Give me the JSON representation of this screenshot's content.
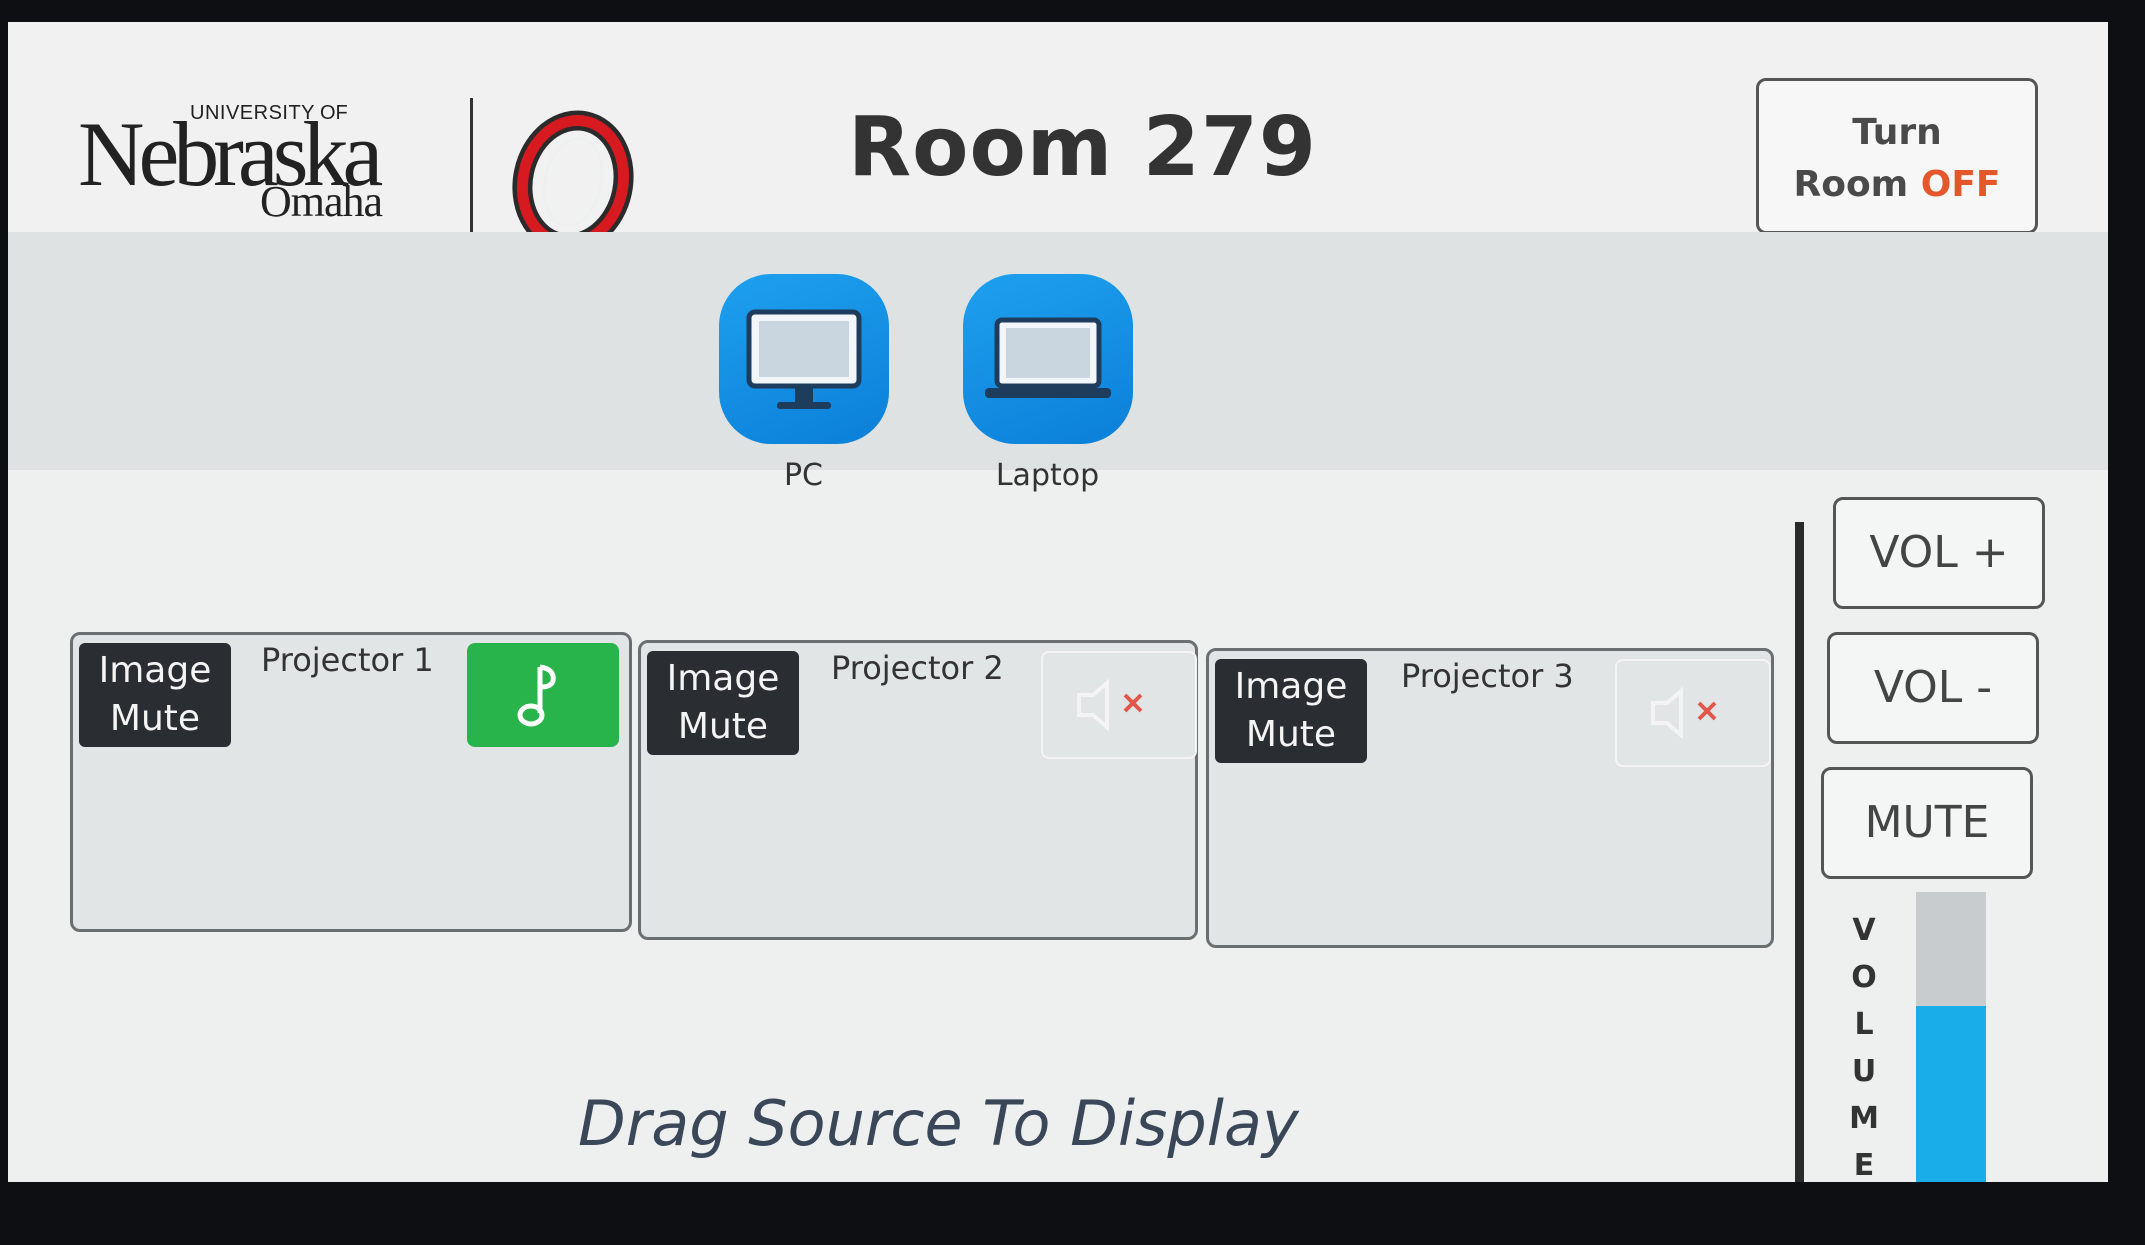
{
  "header": {
    "logo": {
      "university": "UNIVERSITY",
      "of": "OF",
      "nebraska": "Nebraska",
      "omaha": "Omaha"
    },
    "room_title": "Room 279",
    "power_button": {
      "line1": "Turn",
      "line2_prefix": "Room ",
      "line2_state": "OFF"
    }
  },
  "sources": [
    {
      "label": "PC",
      "icon": "desktop-monitor-icon"
    },
    {
      "label": "Laptop",
      "icon": "laptop-icon"
    }
  ],
  "projectors": [
    {
      "label": "Projector 1",
      "image_mute_line1": "Image",
      "image_mute_line2": "Mute",
      "audio_state": "on",
      "audio_icon": "music-note-icon"
    },
    {
      "label": "Projector 2",
      "image_mute_line1": "Image",
      "image_mute_line2": "Mute",
      "audio_state": "muted",
      "audio_icon": "speaker-muted-icon"
    },
    {
      "label": "Projector 3",
      "image_mute_line1": "Image",
      "image_mute_line2": "Mute",
      "audio_state": "muted",
      "audio_icon": "speaker-muted-icon"
    }
  ],
  "volume": {
    "up_label": "VOL +",
    "down_label": "VOL -",
    "mute_label": "MUTE",
    "letters": [
      "V",
      "O",
      "L",
      "U",
      "M",
      "E"
    ],
    "level": 0.62
  },
  "hint": "Drag Source To Display",
  "colors": {
    "accent_blue": "#0b7fd9",
    "audio_on_green": "#28b34b",
    "off_orange": "#e3572b",
    "volume_fill": "#19aeea",
    "brand_red": "#d71920"
  }
}
